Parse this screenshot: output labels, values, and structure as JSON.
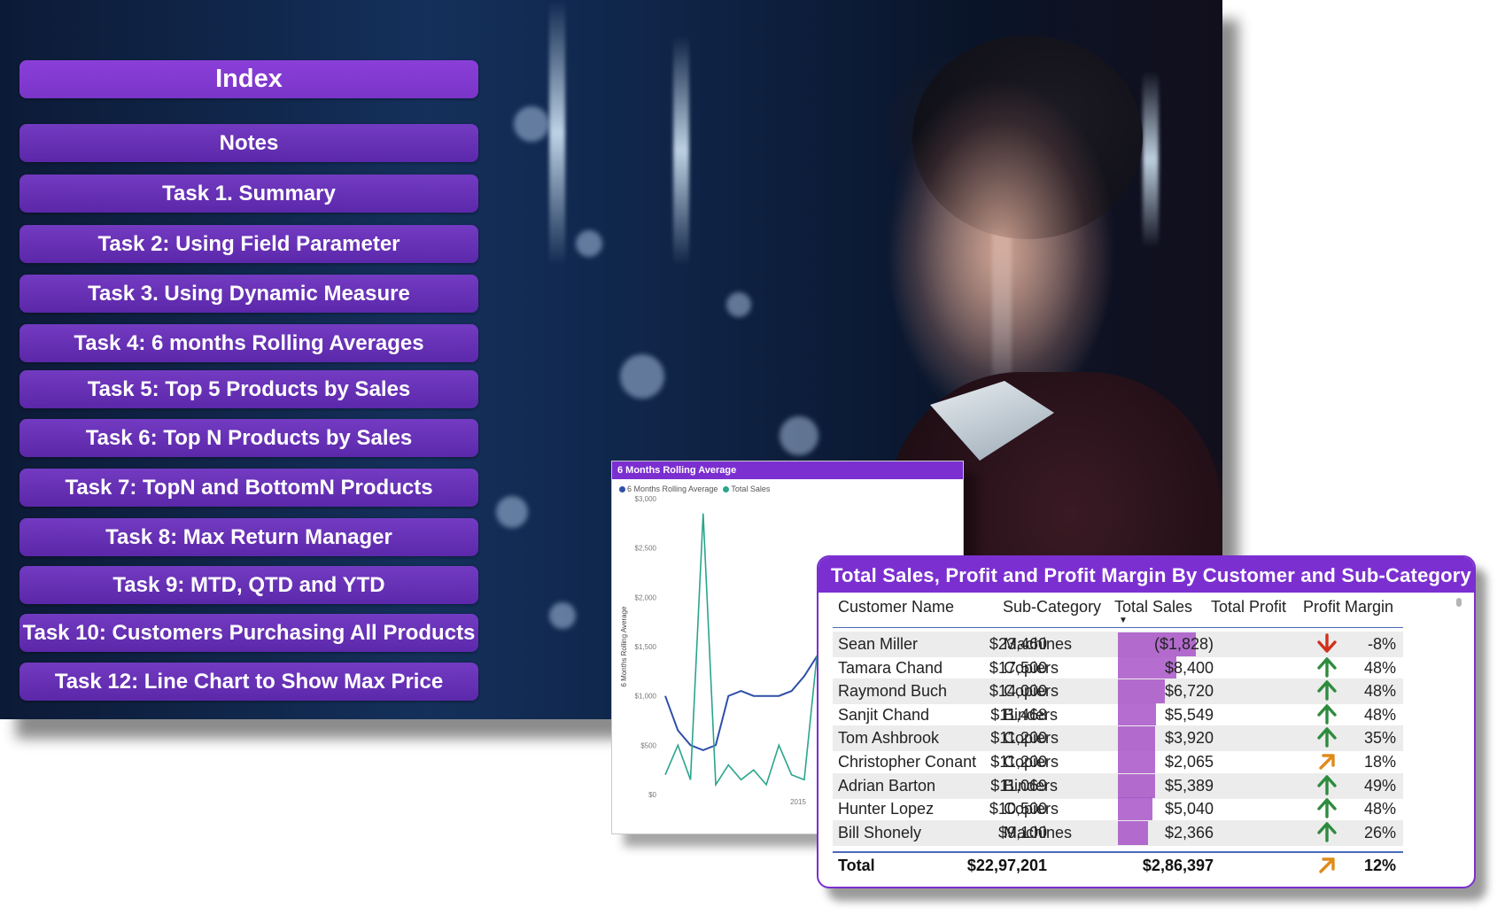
{
  "index": {
    "title": "Index",
    "items": [
      "Notes",
      "Task 1. Summary",
      "Task 2: Using Field Parameter",
      "Task 3. Using Dynamic Measure",
      "Task 4: 6 months Rolling Averages",
      "Task 5: Top 5 Products by Sales",
      "Task 6: Top N Products by Sales",
      "Task 7: TopN and BottomN Products",
      "Task 8: Max Return Manager",
      "Task 9: MTD, QTD and YTD",
      "Task 10: Customers Purchasing All Products",
      "Task 12: Line Chart to Show Max Price"
    ]
  },
  "chart_data": {
    "type": "line",
    "title": "6 Months Rolling Average",
    "ylabel": "6 Months Rolling Average",
    "xlabel": "",
    "ylim": [
      0,
      3000
    ],
    "y_ticks": [
      "$0",
      "$500",
      "$1,000",
      "$1,500",
      "$2,000",
      "$2,500",
      "$3,000"
    ],
    "x_ticks": [
      "2015"
    ],
    "legend": "top-left",
    "series": [
      {
        "name": "6 Months Rolling Average",
        "color": "#2f4fa8",
        "values": [
          1000,
          650,
          500,
          450,
          500,
          1000,
          1050,
          1000,
          1000,
          1000,
          1050,
          1200,
          1400,
          1350,
          1500,
          1550,
          1500,
          1650,
          1800,
          1900,
          2000,
          2000,
          1950,
          2050
        ]
      },
      {
        "name": "Total Sales",
        "color": "#2aa58c",
        "values": [
          200,
          500,
          150,
          2850,
          100,
          300,
          150,
          250,
          100,
          500,
          200,
          150,
          1400,
          300,
          200,
          700,
          150,
          400,
          200,
          1500,
          300,
          900,
          250,
          600
        ]
      }
    ]
  },
  "table": {
    "title": "Total Sales, Profit and Profit Margin By Customer and Sub-Category",
    "headers": [
      "Customer Name",
      "Sub-Category",
      "Total Sales",
      "Total Profit",
      "Profit Margin"
    ],
    "max_sales": 23460,
    "rows": [
      {
        "name": "Sean Miller",
        "sub": "Machines",
        "sales": "$23,460",
        "sales_value": 23460,
        "profit": "($1,828)",
        "margin": "-8%",
        "arrow": "down"
      },
      {
        "name": "Tamara Chand",
        "sub": "Copiers",
        "sales": "$17,500",
        "sales_value": 17500,
        "profit": "$8,400",
        "margin": "48%",
        "arrow": "up"
      },
      {
        "name": "Raymond Buch",
        "sub": "Copiers",
        "sales": "$14,000",
        "sales_value": 14000,
        "profit": "$6,720",
        "margin": "48%",
        "arrow": "up"
      },
      {
        "name": "Sanjit Chand",
        "sub": "Binders",
        "sales": "$11,468",
        "sales_value": 11468,
        "profit": "$5,549",
        "margin": "48%",
        "arrow": "up"
      },
      {
        "name": "Tom Ashbrook",
        "sub": "Copiers",
        "sales": "$11,200",
        "sales_value": 11200,
        "profit": "$3,920",
        "margin": "35%",
        "arrow": "up"
      },
      {
        "name": "Christopher Conant",
        "sub": "Copiers",
        "sales": "$11,200",
        "sales_value": 11200,
        "profit": "$2,065",
        "margin": "18%",
        "arrow": "diag"
      },
      {
        "name": "Adrian Barton",
        "sub": "Binders",
        "sales": "$11,069",
        "sales_value": 11069,
        "profit": "$5,389",
        "margin": "49%",
        "arrow": "up"
      },
      {
        "name": "Hunter Lopez",
        "sub": "Copiers",
        "sales": "$10,500",
        "sales_value": 10500,
        "profit": "$5,040",
        "margin": "48%",
        "arrow": "up"
      },
      {
        "name": "Bill Shonely",
        "sub": "Machines",
        "sales": "$9,100",
        "sales_value": 9100,
        "profit": "$2,366",
        "margin": "26%",
        "arrow": "up"
      }
    ],
    "total": {
      "label": "Total",
      "sales": "$22,97,201",
      "profit": "$2,86,397",
      "margin": "12%",
      "arrow": "diag"
    }
  },
  "colors": {
    "accent": "#7b2fd0",
    "arrow_up": "#2e8b3e",
    "arrow_down": "#d0301c",
    "arrow_diag": "#e08a1a",
    "bar": "#a855c8"
  }
}
